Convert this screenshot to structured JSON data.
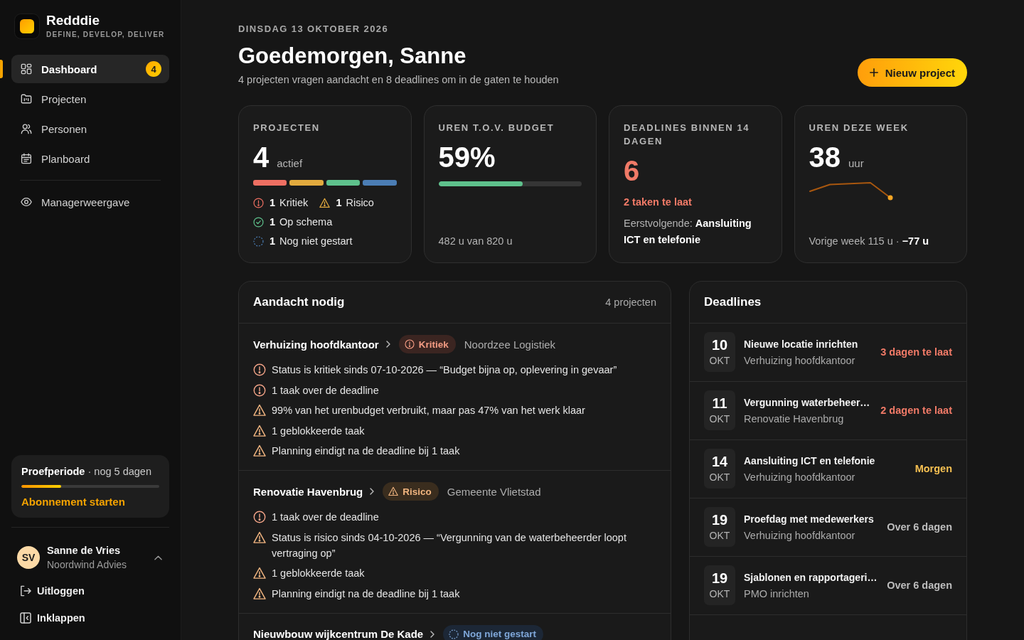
{
  "sidebar": {
    "brand": {
      "name": "Redddie",
      "tagline": "DEFINE, DEVELOP, DELIVER"
    },
    "nav": [
      {
        "label": "Dashboard",
        "selected": true,
        "badge": "4"
      },
      {
        "label": "Projecten",
        "selected": false
      },
      {
        "label": "Personen",
        "selected": false
      },
      {
        "label": "Planboard",
        "selected": false
      }
    ],
    "secondary_nav": [
      {
        "label": "Managerweergave",
        "selected": false
      }
    ],
    "trial": {
      "status": "**Proefperiode** · nog 5 dagen",
      "level": 0.29,
      "action": "Abonnement starten"
    },
    "user": {
      "initials": "SV",
      "name": "Sanne de Vries",
      "organization": "Noordwind Advies",
      "expanded": true
    },
    "actions": [
      {
        "label": "Uitloggen"
      },
      {
        "label": "Inklappen"
      }
    ]
  },
  "header": {
    "date": "DINSDAG 13 OKTOBER 2026",
    "title": "Goedemorgen, Sanne",
    "subtitle": "4 projecten vragen aandacht en 8 deadlines om in de gaten te houden",
    "button": "Nieuw project"
  },
  "stats": [
    {
      "kind": "status",
      "label": "PROJECTEN",
      "value": "4",
      "unit": "actief",
      "statuses": [
        {
          "kind": "critical",
          "count": "1",
          "label": "Kritiek",
          "color": "#ee6f62"
        },
        {
          "kind": "risk",
          "count": "1",
          "label": "Risico",
          "color": "#e2aa3e"
        },
        {
          "kind": "on_track",
          "count": "1",
          "label": "Op schema",
          "color": "#5ec18c"
        },
        {
          "kind": "not_started",
          "count": "1",
          "label": "Nog niet gestart",
          "color": "#4b7db4"
        }
      ]
    },
    {
      "kind": "progress",
      "label": "UREN T.O.V. BUDGET",
      "value": "59%",
      "level": 0.59,
      "footer": "482 u van 820 u"
    },
    {
      "kind": "deadlines",
      "label": "DEADLINES BINNEN 14 DAGEN",
      "value": "6",
      "alert": "2 taken te laat",
      "footer": "Eerstvolgende: **Aansluiting ICT en telefonie**"
    },
    {
      "kind": "trend",
      "label": "UREN DEZE WEEK",
      "value": "38",
      "unit": "uur",
      "footer": "Vorige week 115 u · **−77 u**"
    }
  ],
  "attention": {
    "title": "Aandacht nodig",
    "count": "4 projecten",
    "projects": [
      {
        "name": "Verhuizing hoofdkantoor",
        "status": {
          "kind": "critical",
          "label": "Kritiek"
        },
        "client": "Noordzee Logistiek",
        "issues": [
          {
            "kind": "critical",
            "text": "Status is kritiek sinds 07-10-2026 — “Budget bijna op, oplevering in gevaar”"
          },
          {
            "kind": "critical",
            "text": "1 taak over de deadline"
          },
          {
            "kind": "warning",
            "text": "99% van het urenbudget verbruikt, maar pas 47% van het werk klaar"
          },
          {
            "kind": "warning",
            "text": "1 geblokkeerde taak"
          },
          {
            "kind": "warning",
            "text": "Planning eindigt na de deadline bij 1 taak"
          }
        ]
      },
      {
        "name": "Renovatie Havenbrug",
        "status": {
          "kind": "risk",
          "label": "Risico"
        },
        "client": "Gemeente Vlietstad",
        "issues": [
          {
            "kind": "critical",
            "text": "1 taak over de deadline"
          },
          {
            "kind": "warning",
            "text": "Status is risico sinds 04-10-2026 — “Vergunning van de waterbeheerder loopt vertraging op”"
          },
          {
            "kind": "warning",
            "text": "1 geblokkeerde taak"
          },
          {
            "kind": "warning",
            "text": "Planning eindigt na de deadline bij 1 taak"
          }
        ]
      },
      {
        "name": "Nieuwbouw wijkcentrum De Kade",
        "status": {
          "kind": "not_started",
          "label": "Nog niet gestart"
        }
      }
    ]
  },
  "deadlines": {
    "title": "Deadlines",
    "items": [
      {
        "day": "10",
        "month": "OKT",
        "title": "Nieuwe locatie inrichten",
        "project": "Verhuizing hoofdkantoor",
        "due": "3 dagen te laat",
        "color": "#f07a67"
      },
      {
        "day": "11",
        "month": "OKT",
        "title": "Vergunning waterbeheer…",
        "project": "Renovatie Havenbrug",
        "due": "2 dagen te laat",
        "color": "#f07a67"
      },
      {
        "day": "14",
        "month": "OKT",
        "title": "Aansluiting ICT en telefonie",
        "project": "Verhuizing hoofdkantoor",
        "due": "Morgen",
        "color": "#f5c052"
      },
      {
        "day": "19",
        "month": "OKT",
        "title": "Proefdag met medewerkers",
        "project": "Verhuizing hoofdkantoor",
        "due": "Over 6 dagen",
        "color": "#bdbdbd"
      },
      {
        "day": "19",
        "month": "OKT",
        "title": "Sjablonen en rapportageri…",
        "project": "PMO inrichten",
        "due": "Over 6 dagen",
        "color": "#bdbdbd"
      }
    ]
  }
}
